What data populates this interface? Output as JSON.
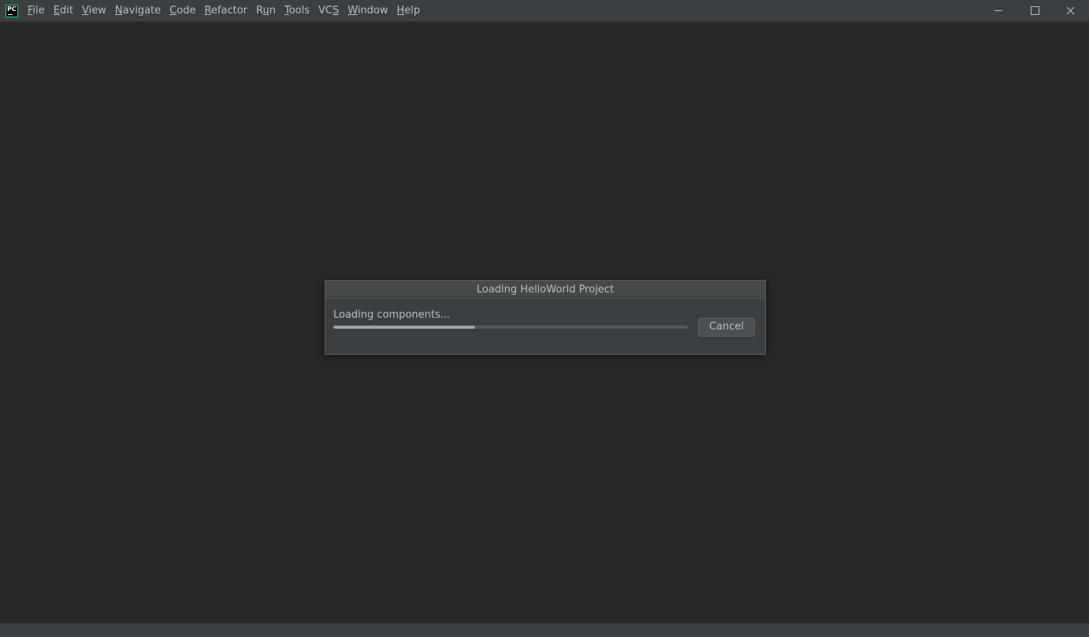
{
  "app": {
    "logo_text": "PC"
  },
  "menu": {
    "items": [
      {
        "mnemonic": "F",
        "rest": "ile"
      },
      {
        "mnemonic": "E",
        "rest": "dit"
      },
      {
        "mnemonic": "V",
        "rest": "iew"
      },
      {
        "mnemonic": "N",
        "rest": "avigate"
      },
      {
        "mnemonic": "C",
        "rest": "ode"
      },
      {
        "mnemonic": "R",
        "rest": "efactor"
      },
      {
        "pre": "R",
        "mnemonic": "u",
        "rest": "n"
      },
      {
        "mnemonic": "T",
        "rest": "ools"
      },
      {
        "pre": "VC",
        "mnemonic": "S",
        "rest": ""
      },
      {
        "mnemonic": "W",
        "rest": "indow"
      },
      {
        "mnemonic": "H",
        "rest": "elp"
      }
    ]
  },
  "window_controls": {
    "icons": [
      "minimize-icon",
      "maximize-icon",
      "close-icon"
    ]
  },
  "dialog": {
    "title": "Loading HelloWorld Project",
    "message": "Loading components...",
    "progress_fraction": 0.4,
    "cancel_label": "Cancel"
  },
  "colors": {
    "background": "#282828",
    "chrome": "#3c3f41",
    "text": "#bbbbbb",
    "logo_accent": "#21d789"
  }
}
